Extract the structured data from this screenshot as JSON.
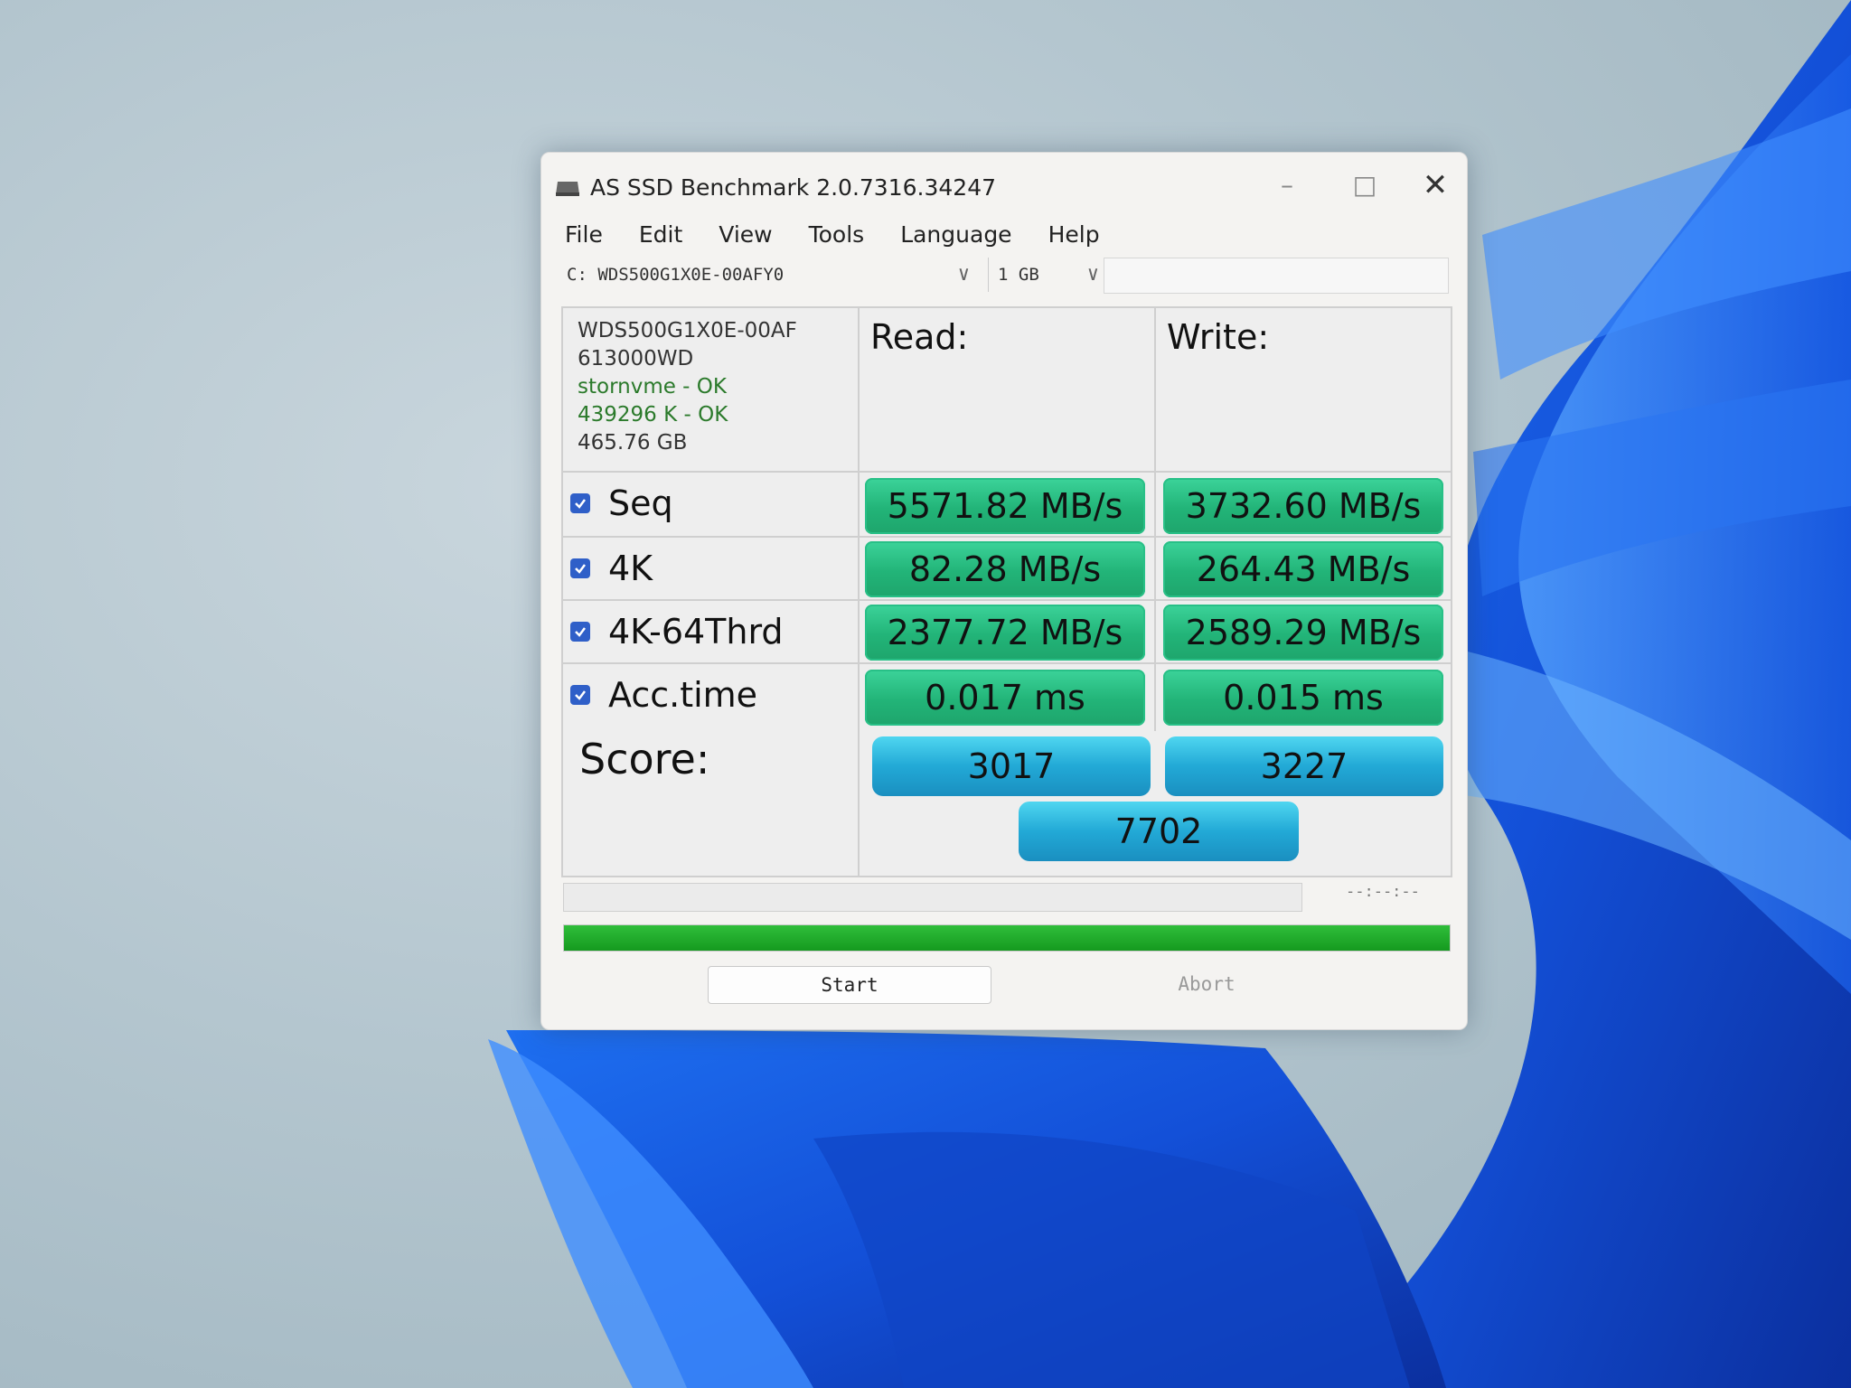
{
  "window": {
    "title": "AS SSD Benchmark 2.0.7316.34247",
    "controls": {
      "minimize": "–",
      "maximize": "□",
      "close": "✕"
    }
  },
  "menu": [
    "File",
    "Edit",
    "View",
    "Tools",
    "Language",
    "Help"
  ],
  "selectors": {
    "drive": "C: WDS500G1X0E-00AFY0",
    "test_size": "1 GB"
  },
  "drive_info": {
    "model": "WDS500G1X0E-00AF",
    "firmware": "613000WD",
    "driver": "stornvme - OK",
    "alignment": "439296 K - OK",
    "capacity": "465.76 GB"
  },
  "columns": {
    "read": "Read:",
    "write": "Write:"
  },
  "tests": [
    {
      "label": "Seq",
      "checked": true,
      "read": "5571.82 MB/s",
      "write": "3732.60 MB/s"
    },
    {
      "label": "4K",
      "checked": true,
      "read": "82.28 MB/s",
      "write": "264.43 MB/s"
    },
    {
      "label": "4K-64Thrd",
      "checked": true,
      "read": "2377.72 MB/s",
      "write": "2589.29 MB/s"
    },
    {
      "label": "Acc.time",
      "checked": true,
      "read": "0.017 ms",
      "write": "0.015 ms"
    }
  ],
  "score": {
    "label": "Score:",
    "read": "3017",
    "write": "3227",
    "total": "7702"
  },
  "time_readout": "--:--:--",
  "progress": 1.0,
  "buttons": {
    "start": "Start",
    "abort": "Abort"
  },
  "colors": {
    "result_green": "#22b478",
    "score_blue": "#22a9d6",
    "progress_green": "#159a1f",
    "checkbox_blue": "#2f5fc8"
  },
  "icons": {
    "app": "hard-drive-icon",
    "chevron": "chevron-down-icon",
    "check": "check-icon"
  }
}
